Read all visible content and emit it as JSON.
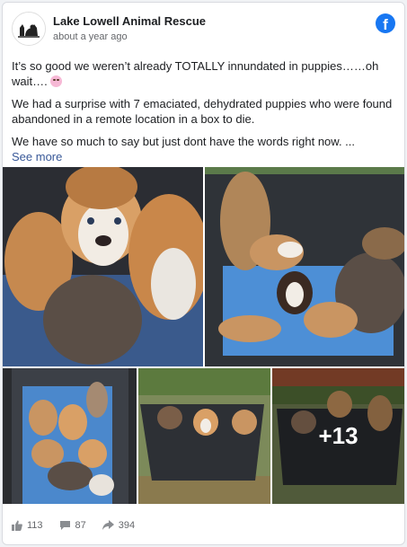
{
  "post": {
    "page_name": "Lake Lowell Animal Rescue",
    "timestamp": "about a year ago",
    "paragraph1": "It’s so good we weren’t already TOTALLY innundated in puppies……oh wait….",
    "paragraph2": "We had a surprise with 7 emaciated, dehydrated puppies who were found abandoned in a remote location in a box to die.",
    "paragraph3": "We have so much to say but just dont have the words right now. ...",
    "see_more": "See more"
  },
  "photos": {
    "more_count": "+13"
  },
  "stats": {
    "likes": "113",
    "comments": "87",
    "shares": "394"
  },
  "icons": {
    "logo": "facebook-icon",
    "emoji": "weary-face-emoji",
    "like": "thumbs-up-icon",
    "comment": "comment-icon",
    "share": "share-icon"
  },
  "colors": {
    "facebook_blue": "#1877f2",
    "link": "#385898"
  }
}
